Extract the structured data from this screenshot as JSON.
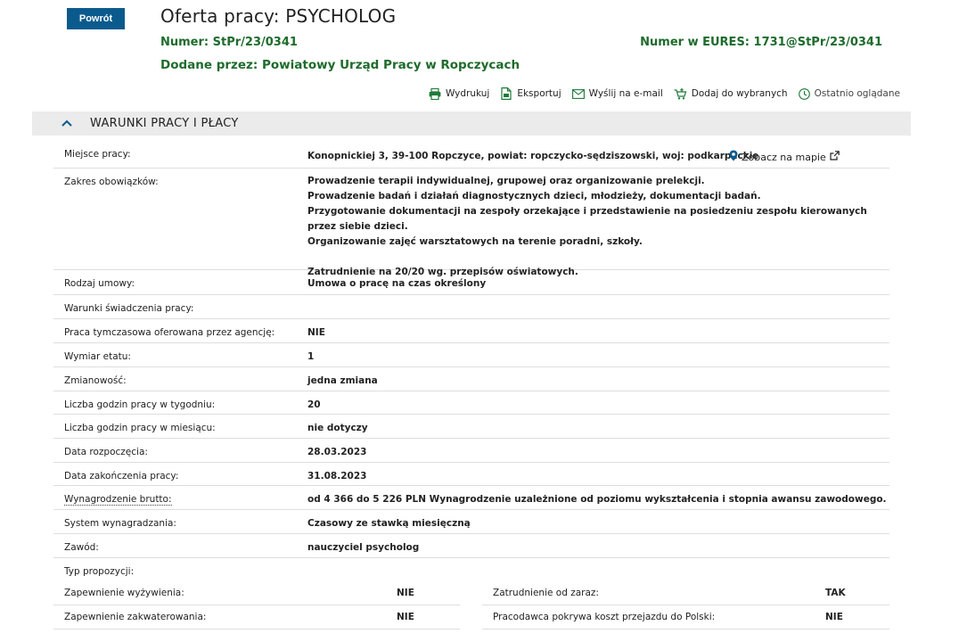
{
  "header": {
    "back_label": "Powrót",
    "title": "Oferta pracy: PSYCHOLOG",
    "numer_label": "Numer:",
    "numer_value": "StPr/23/0341",
    "eures_label": "Numer w EURES:",
    "eures_value": "1731@StPr/23/0341",
    "dodane_label": "Dodane przez:",
    "dodane_value": "Powiatowy Urząd Pracy w Ropczycach"
  },
  "toolbar": {
    "print": "Wydrukuj",
    "export": "Eksportuj",
    "email": "Wyślij na e-mail",
    "favorites": "Dodaj do wybranych",
    "recent": "Ostatnio oglądane"
  },
  "section": {
    "title": "WARUNKI PRACY I PŁACY"
  },
  "fields": {
    "miejsce": {
      "label": "Miejsce pracy:",
      "value": "Konopnickiej 3, 39-100 Ropczyce, powiat: ropczycko-sędziszowski, woj: podkarpackie",
      "map": "Zobacz na mapie"
    },
    "zakres": {
      "label": "Zakres obowiązków:",
      "lines": [
        "Prowadzenie terapii indywidualnej, grupowej oraz organizowanie prelekcji.",
        "Prowadzenie badań i działań diagnostycznych dzieci, młodzieży, dokumentacji badań.",
        "Przygotowanie dokumentacji na zespoły orzekające i przedstawienie na posiedzeniu zespołu kierowanych przez siebie dzieci.",
        "Organizowanie zajęć warsztatowych na terenie poradni, szkoły.",
        "Zatrudnienie na 20/20 wg. przepisów oświatowych."
      ]
    },
    "rodzaj": {
      "label": "Rodzaj umowy:",
      "value": "Umowa o pracę na czas określony"
    },
    "warunki": {
      "label": "Warunki świadczenia pracy:",
      "value": ""
    },
    "tymczasowa": {
      "label": "Praca tymczasowa oferowana przez agencję:",
      "value": "NIE"
    },
    "wymiar": {
      "label": "Wymiar etatu:",
      "value": "1"
    },
    "zmianowosc": {
      "label": "Zmianowość:",
      "value": "jedna zmiana"
    },
    "godz_tydz": {
      "label": "Liczba godzin pracy w tygodniu:",
      "value": "20"
    },
    "godz_mies": {
      "label": "Liczba godzin pracy w miesiącu:",
      "value": "nie dotyczy"
    },
    "data_rozp": {
      "label": "Data rozpoczęcia:",
      "value": "28.03.2023"
    },
    "data_zak": {
      "label": "Data zakończenia pracy:",
      "value": "31.08.2023"
    },
    "wynagrodzenie": {
      "label": "Wynagrodzenie brutto:",
      "value": "od 4 366 do 5 226 PLN Wynagrodzenie uzależnione od poziomu wykształcenia i stopnia awansu zawodowego."
    },
    "system": {
      "label": "System wynagradzania:",
      "value": "Czasowy ze stawką miesięczną"
    },
    "zawod": {
      "label": "Zawód:",
      "value": "nauczyciel psycholog"
    },
    "typ": {
      "label": "Typ propozycji:"
    }
  },
  "pairs": {
    "wyzywienie": {
      "label": "Zapewnienie wyżywienia:",
      "value": "NIE"
    },
    "od_zaraz": {
      "label": "Zatrudnienie od zaraz:",
      "value": "TAK"
    },
    "zakwaterowanie": {
      "label": "Zapewnienie zakwaterowania:",
      "value": "NIE"
    },
    "przejazd": {
      "label": "Pracodawca pokrywa koszt przejazdu do Polski:",
      "value": "NIE"
    }
  },
  "colors": {
    "primary": "#0b5a8e",
    "green": "#1e6b2c",
    "section_bg": "#ebebeb"
  }
}
